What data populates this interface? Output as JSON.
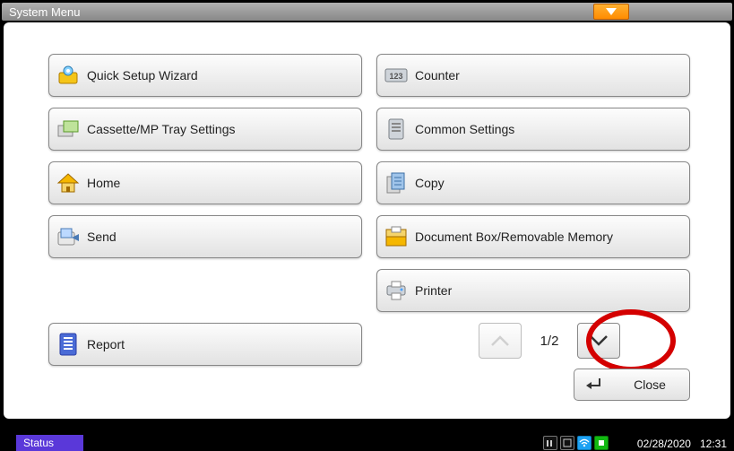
{
  "title": "System Menu",
  "menu": {
    "items": [
      {
        "label": "Quick Setup Wizard",
        "icon": "wizard"
      },
      {
        "label": "Counter",
        "icon": "counter"
      },
      {
        "label": "Cassette/MP Tray Settings",
        "icon": "tray"
      },
      {
        "label": "Common Settings",
        "icon": "common"
      },
      {
        "label": "Home",
        "icon": "home"
      },
      {
        "label": "Copy",
        "icon": "copy"
      },
      {
        "label": "Send",
        "icon": "send"
      },
      {
        "label": "Document Box/Removable Memory",
        "icon": "docbox"
      },
      {
        "label": "",
        "icon": ""
      },
      {
        "label": "Printer",
        "icon": "printer"
      }
    ],
    "report_label": "Report"
  },
  "pager": {
    "text": "1/2"
  },
  "close_label": "Close",
  "status": {
    "label": "Status",
    "date": "02/28/2020",
    "time": "12:31"
  }
}
